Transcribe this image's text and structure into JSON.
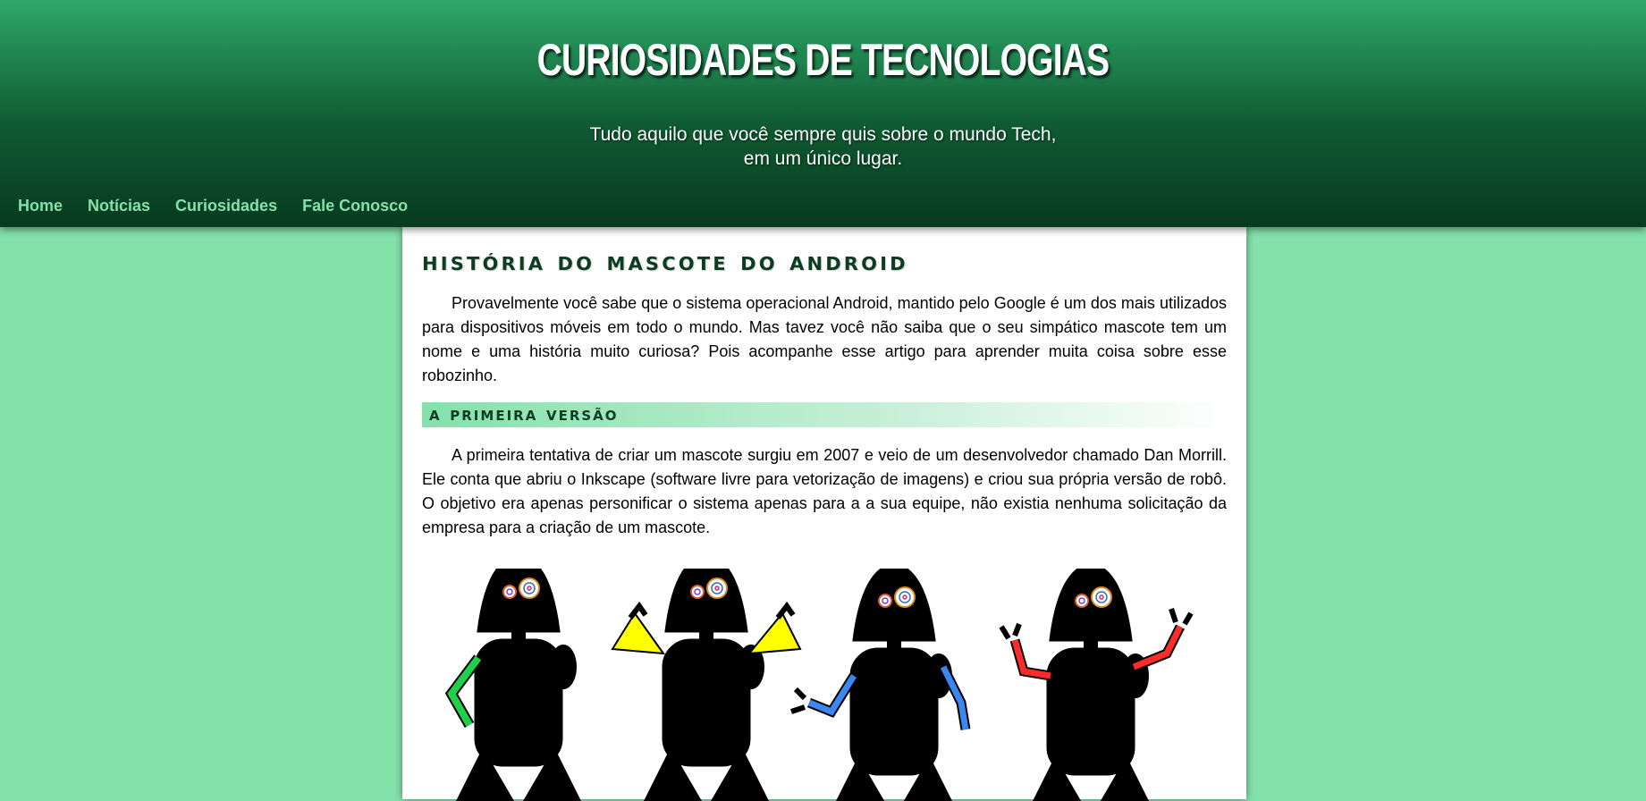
{
  "header": {
    "title": "CURIOSIDADES DE TECNOLOGIAS",
    "subtitle_line1": "Tudo aquilo que você sempre quis sobre o mundo Tech,",
    "subtitle_line2": "em um único lugar."
  },
  "nav": {
    "items": [
      {
        "label": "Home"
      },
      {
        "label": "Notícias"
      },
      {
        "label": "Curiosidades"
      },
      {
        "label": "Fale Conosco"
      }
    ]
  },
  "article": {
    "title": "História do Mascote do Android",
    "intro": "Provavelmente você sabe que o sistema operacional Android, mantido pelo Google é um dos mais utilizados para dispositivos móveis em todo o mundo. Mas tavez você não saiba que o seu simpático mascote tem um nome e uma história muito curiosa? Pois acompanhe esse artigo para aprender muita coisa sobre esse robozinho.",
    "section1_title": "A primeira versão",
    "section1_text": "A primeira tentativa de criar um mascote surgiu em 2007 e veio de um desenvolvedor chamado Dan Morrill. Ele conta que abriu o Inkscape (software livre para vetorização de imagens) e criou sua própria versão de robô. O objetivo era apenas personificar o sistema apenas para a a sua equipe, não existia nenhuma solicitação da empresa para a criação de um mascote."
  },
  "colors": {
    "background": "#84e1aa",
    "header_dark": "#073a1f",
    "header_light": "#2ea86a",
    "title_text": "#0c3d22",
    "robot_colors": [
      "#1fd14a",
      "#ffff00",
      "#3a87f0",
      "#ff2a2a"
    ]
  }
}
